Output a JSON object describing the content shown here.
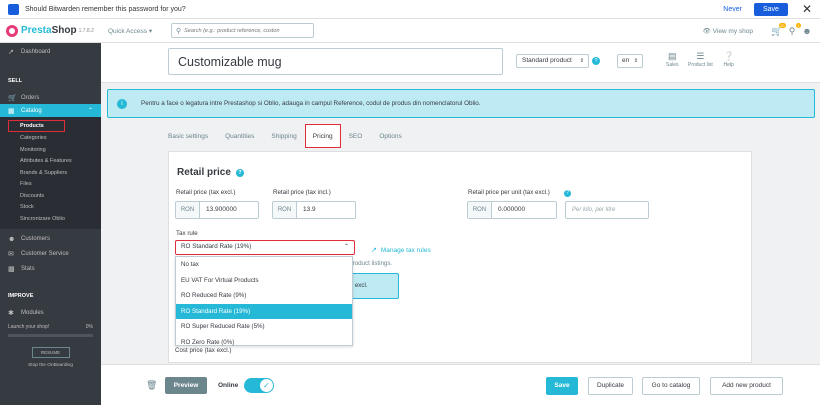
{
  "bitwarden": {
    "message": "Should Bitwarden remember this password for you?",
    "never": "Never",
    "save": "Save",
    "close": "✕"
  },
  "topbar": {
    "logo_part1": "Presta",
    "logo_part2": "Shop",
    "version": "1.7.8.2",
    "quick_access": "Quick Access ▾",
    "search_placeholder": "Search (e.g.: product reference, custon",
    "view_shop": "View my shop",
    "notif_count_1": "10",
    "notif_count_2": "1"
  },
  "sidebar": {
    "dashboard": "Dashboard",
    "sell_heading": "SELL",
    "orders": "Orders",
    "catalog": "Catalog",
    "catalog_items": [
      "Products",
      "Categories",
      "Monitoring",
      "Attributes & Features",
      "Brands & Suppliers",
      "Files",
      "Discounts",
      "Stock",
      "Sincronizare Oblio"
    ],
    "customers": "Customers",
    "customer_service": "Customer Service",
    "stats": "Stats",
    "improve_heading": "IMPROVE",
    "modules": "Modules",
    "launch_text": "Launch your shop!",
    "launch_pct": "0%",
    "resume": "RESUME",
    "stop_onboarding": "Stop the OnBoarding"
  },
  "product": {
    "name": "Customizable mug",
    "type": "Standard product",
    "lang": "en",
    "sales_label": "Sales",
    "product_list_label": "Product list",
    "help_label": "Help"
  },
  "alert": {
    "text": "Pentru a face o legatura intre Prestashop si Oblio, adauga in campul Reference, codul de produs din nomenclatorul Oblio."
  },
  "tabs": [
    "Basic settings",
    "Quantities",
    "Shipping",
    "Pricing",
    "SEO",
    "Options"
  ],
  "pricing": {
    "section_title": "Retail price",
    "excl_label": "Retail price (tax excl.)",
    "incl_label": "Retail price (tax incl.)",
    "unit_label": "Retail price per unit (tax excl.)",
    "currency": "RON",
    "excl_value": "13.900000",
    "incl_value": "13.9",
    "unit_value": "0.000000",
    "unit_placeholder": "Per kilo, per litre",
    "tax_rule_label": "Tax rule",
    "tax_rule_selected": "RO Standard Rate (19%)",
    "tax_options": [
      "No tax",
      "EU VAT For Virtual Products",
      "RO Reduced Rate (9%)",
      "RO Standard Rate (19%)",
      "RO Super Reduced Rate (5%)",
      "RO Zero Rate (0%)"
    ],
    "manage_tax_rules": "Manage tax rules",
    "listing_note": "e product listings.",
    "blue_box_text": "x excl.",
    "cost_label": "Cost price (tax excl.)"
  },
  "footer": {
    "preview": "Preview",
    "online": "Online",
    "save": "Save",
    "duplicate": "Duplicate",
    "go_to_catalog": "Go to catalog",
    "add_new_product": "Add new product"
  }
}
